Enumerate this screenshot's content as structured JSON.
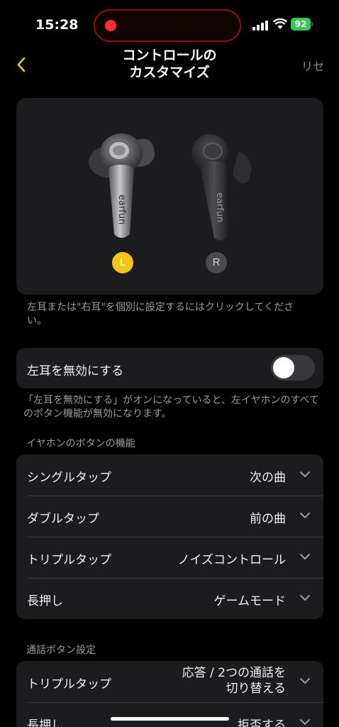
{
  "status_bar": {
    "time": "15:28",
    "battery": "92",
    "battery_color": "#35c759",
    "recording_color": "#ff2d2d"
  },
  "nav": {
    "title_line1": "コントロールの",
    "title_line2": "カスタマイズ",
    "reset_label": "リセ",
    "back_icon": "chevron-left-icon",
    "accent_color": "#f5c518"
  },
  "earbuds": {
    "left_brand": "earfun",
    "right_brand": "earfun",
    "left_badge": "L",
    "right_badge": "R",
    "selected": "L"
  },
  "hint_text": "左耳または\"右耳\"を個別に設定するにはクリックしてください。",
  "disable_toggle": {
    "label": "左耳を無効にする",
    "on": false
  },
  "disable_note": "「左耳を無効にする」がオンになっていると、左イヤホンのすべてのボタン機能が無効になります。",
  "button_section": {
    "header": "イヤホンのボタンの機能",
    "rows": [
      {
        "label": "シングルタップ",
        "value": "次の曲"
      },
      {
        "label": "ダブルタップ",
        "value": "前の曲"
      },
      {
        "label": "トリプルタップ",
        "value": "ノイズコントロール"
      },
      {
        "label": "長押し",
        "value": "ゲームモード"
      }
    ]
  },
  "call_section": {
    "header": "通話ボタン設定",
    "rows": [
      {
        "label": "トリプルタップ",
        "value_line1": "応答 / 2つの通話を",
        "value_line2": "切り替える"
      },
      {
        "label": "長押し",
        "value": "拒否する"
      }
    ]
  }
}
